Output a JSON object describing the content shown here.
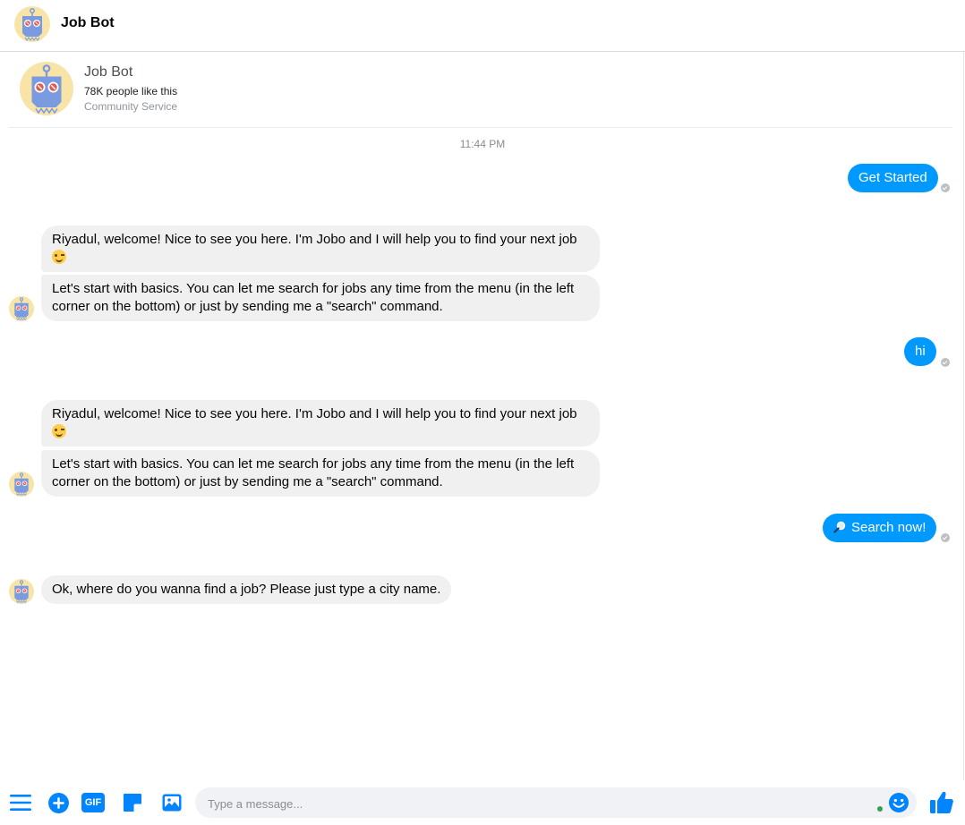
{
  "header": {
    "title": "Job Bot"
  },
  "page_info": {
    "name": "Job Bot",
    "likes": "78K people like this",
    "category": "Community Service"
  },
  "conversation": {
    "timestamp": "11:44 PM",
    "messages": [
      {
        "from": "user",
        "text": "Get Started"
      },
      {
        "from": "bot",
        "text": "Riyadul, welcome! Nice to see you here. I'm Jobo and I will help you to find your next job",
        "emoji": "wink-emoji"
      },
      {
        "from": "bot",
        "text": "Let's start with basics. You can let me search for jobs any time from the menu (in the left corner on the bottom) or just by sending me a \"search\" command."
      },
      {
        "from": "user",
        "text": "hi"
      },
      {
        "from": "bot",
        "text": "Riyadul, welcome! Nice to see you here. I'm Jobo and I will help you to find your next job",
        "emoji": "wink-emoji"
      },
      {
        "from": "bot",
        "text": "Let's start with basics. You can let me search for jobs any time from the menu (in the left corner on the bottom) or just by sending me a \"search\" command."
      },
      {
        "from": "user",
        "text": "Search now!",
        "icon": "magnifier-icon"
      },
      {
        "from": "bot",
        "text": "Ok, where do you wanna find a job? Please just type a city name."
      }
    ]
  },
  "composer": {
    "placeholder": "Type a message...",
    "gif_label": "GIF"
  },
  "colors": {
    "accent": "#0099ff",
    "icon_blue": "#0084ff",
    "incoming_bubble": "#f0f0f0",
    "avatar_bg": "#f7e4a6",
    "robot_blue": "#7b9be0"
  }
}
